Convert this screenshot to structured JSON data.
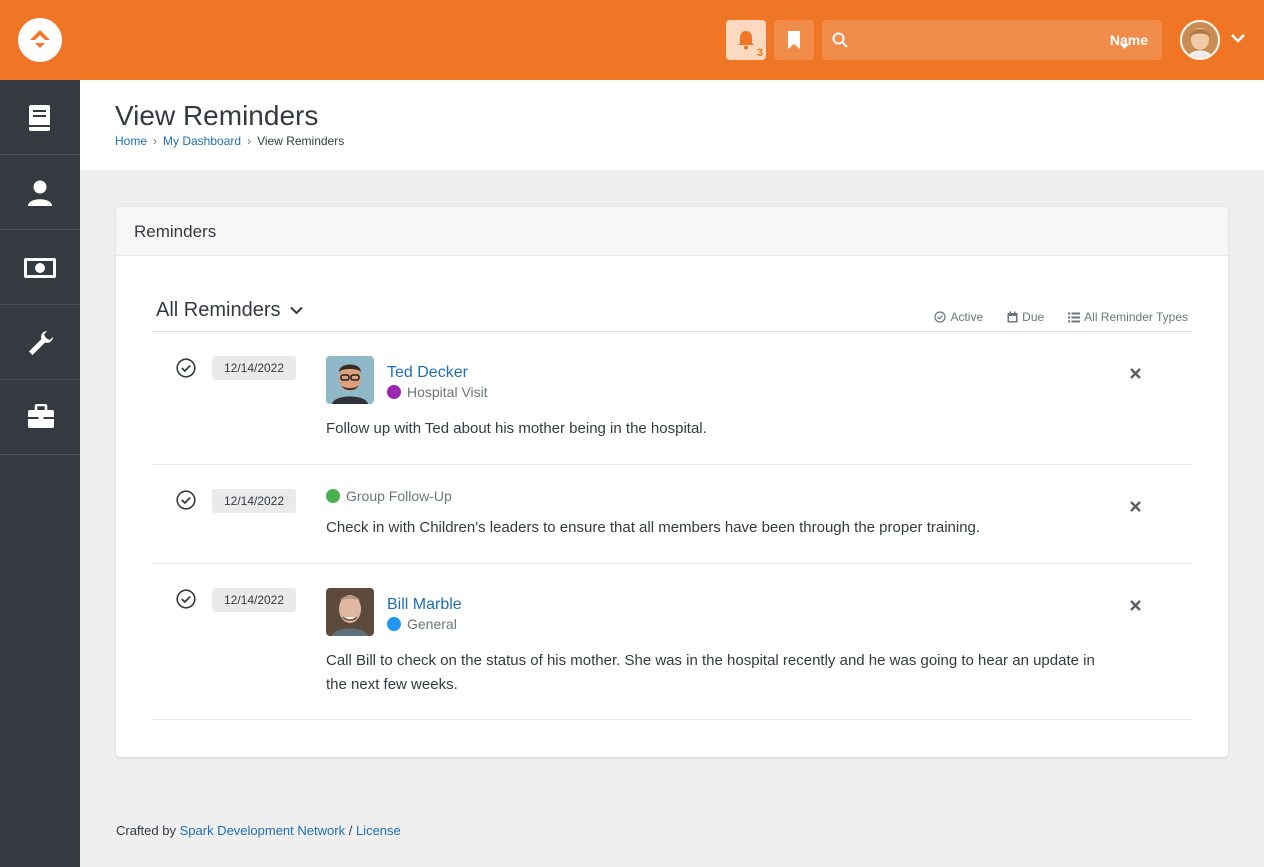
{
  "header": {
    "notification_count": "3",
    "search_placeholder": "",
    "search_filter": "Name",
    "brand_color": "#ee7624"
  },
  "sidebar": {
    "items": [
      {
        "icon": "book-icon"
      },
      {
        "icon": "person-icon"
      },
      {
        "icon": "money-icon"
      },
      {
        "icon": "wrench-icon"
      },
      {
        "icon": "briefcase-icon"
      }
    ]
  },
  "page": {
    "title": "View Reminders",
    "breadcrumb": [
      "Home",
      "My Dashboard",
      "View Reminders"
    ]
  },
  "panel": {
    "heading": "Reminders",
    "filter_title": "All Reminders",
    "filters": {
      "status": "Active",
      "due": "Due",
      "types": "All Reminder Types"
    }
  },
  "reminders": [
    {
      "date": "12/14/2022",
      "person": "Ted Decker",
      "type": "Hospital Visit",
      "type_color": "#9c27b0",
      "note": "Follow up with Ted about his mother being in the hospital."
    },
    {
      "date": "12/14/2022",
      "person": "",
      "type": "Group Follow-Up",
      "type_color": "#4caf50",
      "note": "Check in with Children's leaders to ensure that all members have been through the proper training."
    },
    {
      "date": "12/14/2022",
      "person": "Bill Marble",
      "type": "General",
      "type_color": "#2196f3",
      "note": "Call Bill to check on the status of his mother. She was in the hospital recently and he was going to hear an update in the next few weeks."
    }
  ],
  "footer": {
    "prefix": "Crafted by",
    "org": "Spark Development Network",
    "sep": "/",
    "license": "License"
  }
}
